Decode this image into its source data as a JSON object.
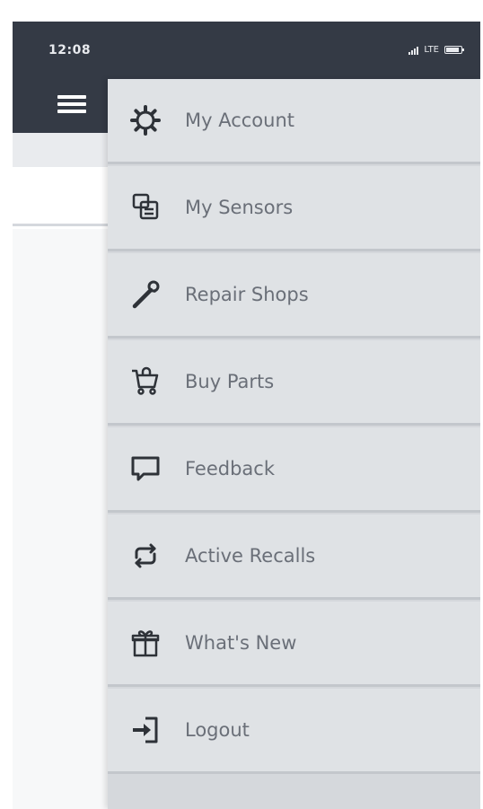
{
  "status_bar": {
    "time": "12:08",
    "network": "LTE",
    "background_color": "#343a45"
  },
  "header": {
    "menu_icon": "hamburger-icon"
  },
  "drawer": {
    "background_color": "#dfe2e5",
    "label_color": "#6a6f78",
    "items": [
      {
        "label": "My Account",
        "icon": "gear-icon"
      },
      {
        "label": "My Sensors",
        "icon": "sensor-icon"
      },
      {
        "label": "Repair Shops",
        "icon": "wrench-icon"
      },
      {
        "label": "Buy Parts",
        "icon": "cart-icon"
      },
      {
        "label": "Feedback",
        "icon": "chat-icon"
      },
      {
        "label": "Active Recalls",
        "icon": "recall-icon"
      },
      {
        "label": "What's New",
        "icon": "gift-icon"
      },
      {
        "label": "Logout",
        "icon": "logout-icon"
      }
    ]
  }
}
